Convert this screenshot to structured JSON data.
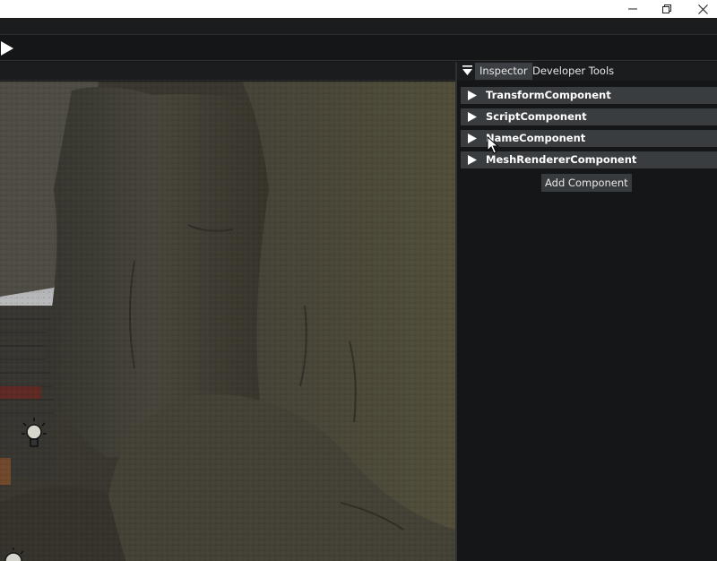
{
  "window": {
    "minimize_icon": "minimize-icon",
    "maximize_icon": "restore-icon",
    "close_icon": "close-icon"
  },
  "toolbar": {
    "play_icon": "play-icon"
  },
  "panel": {
    "menu_icon": "triangle-down-icon",
    "tabs": [
      {
        "label": "Inspector",
        "active": true
      },
      {
        "label": "Developer Tools",
        "active": false
      }
    ]
  },
  "inspector": {
    "components": [
      {
        "label": "TransformComponent",
        "expanded": false
      },
      {
        "label": "ScriptComponent",
        "expanded": false
      },
      {
        "label": "NameComponent",
        "expanded": false
      },
      {
        "label": "MeshRendererComponent",
        "expanded": false
      }
    ],
    "add_component_label": "Add Component"
  },
  "viewport": {
    "light_gizmo_icon": "light-bulb-icon"
  },
  "colors": {
    "panel_bg": "#151617",
    "row_bg": "#3a3d40",
    "active_tab_bg": "#3b3e42",
    "rock": "#4a4538"
  }
}
